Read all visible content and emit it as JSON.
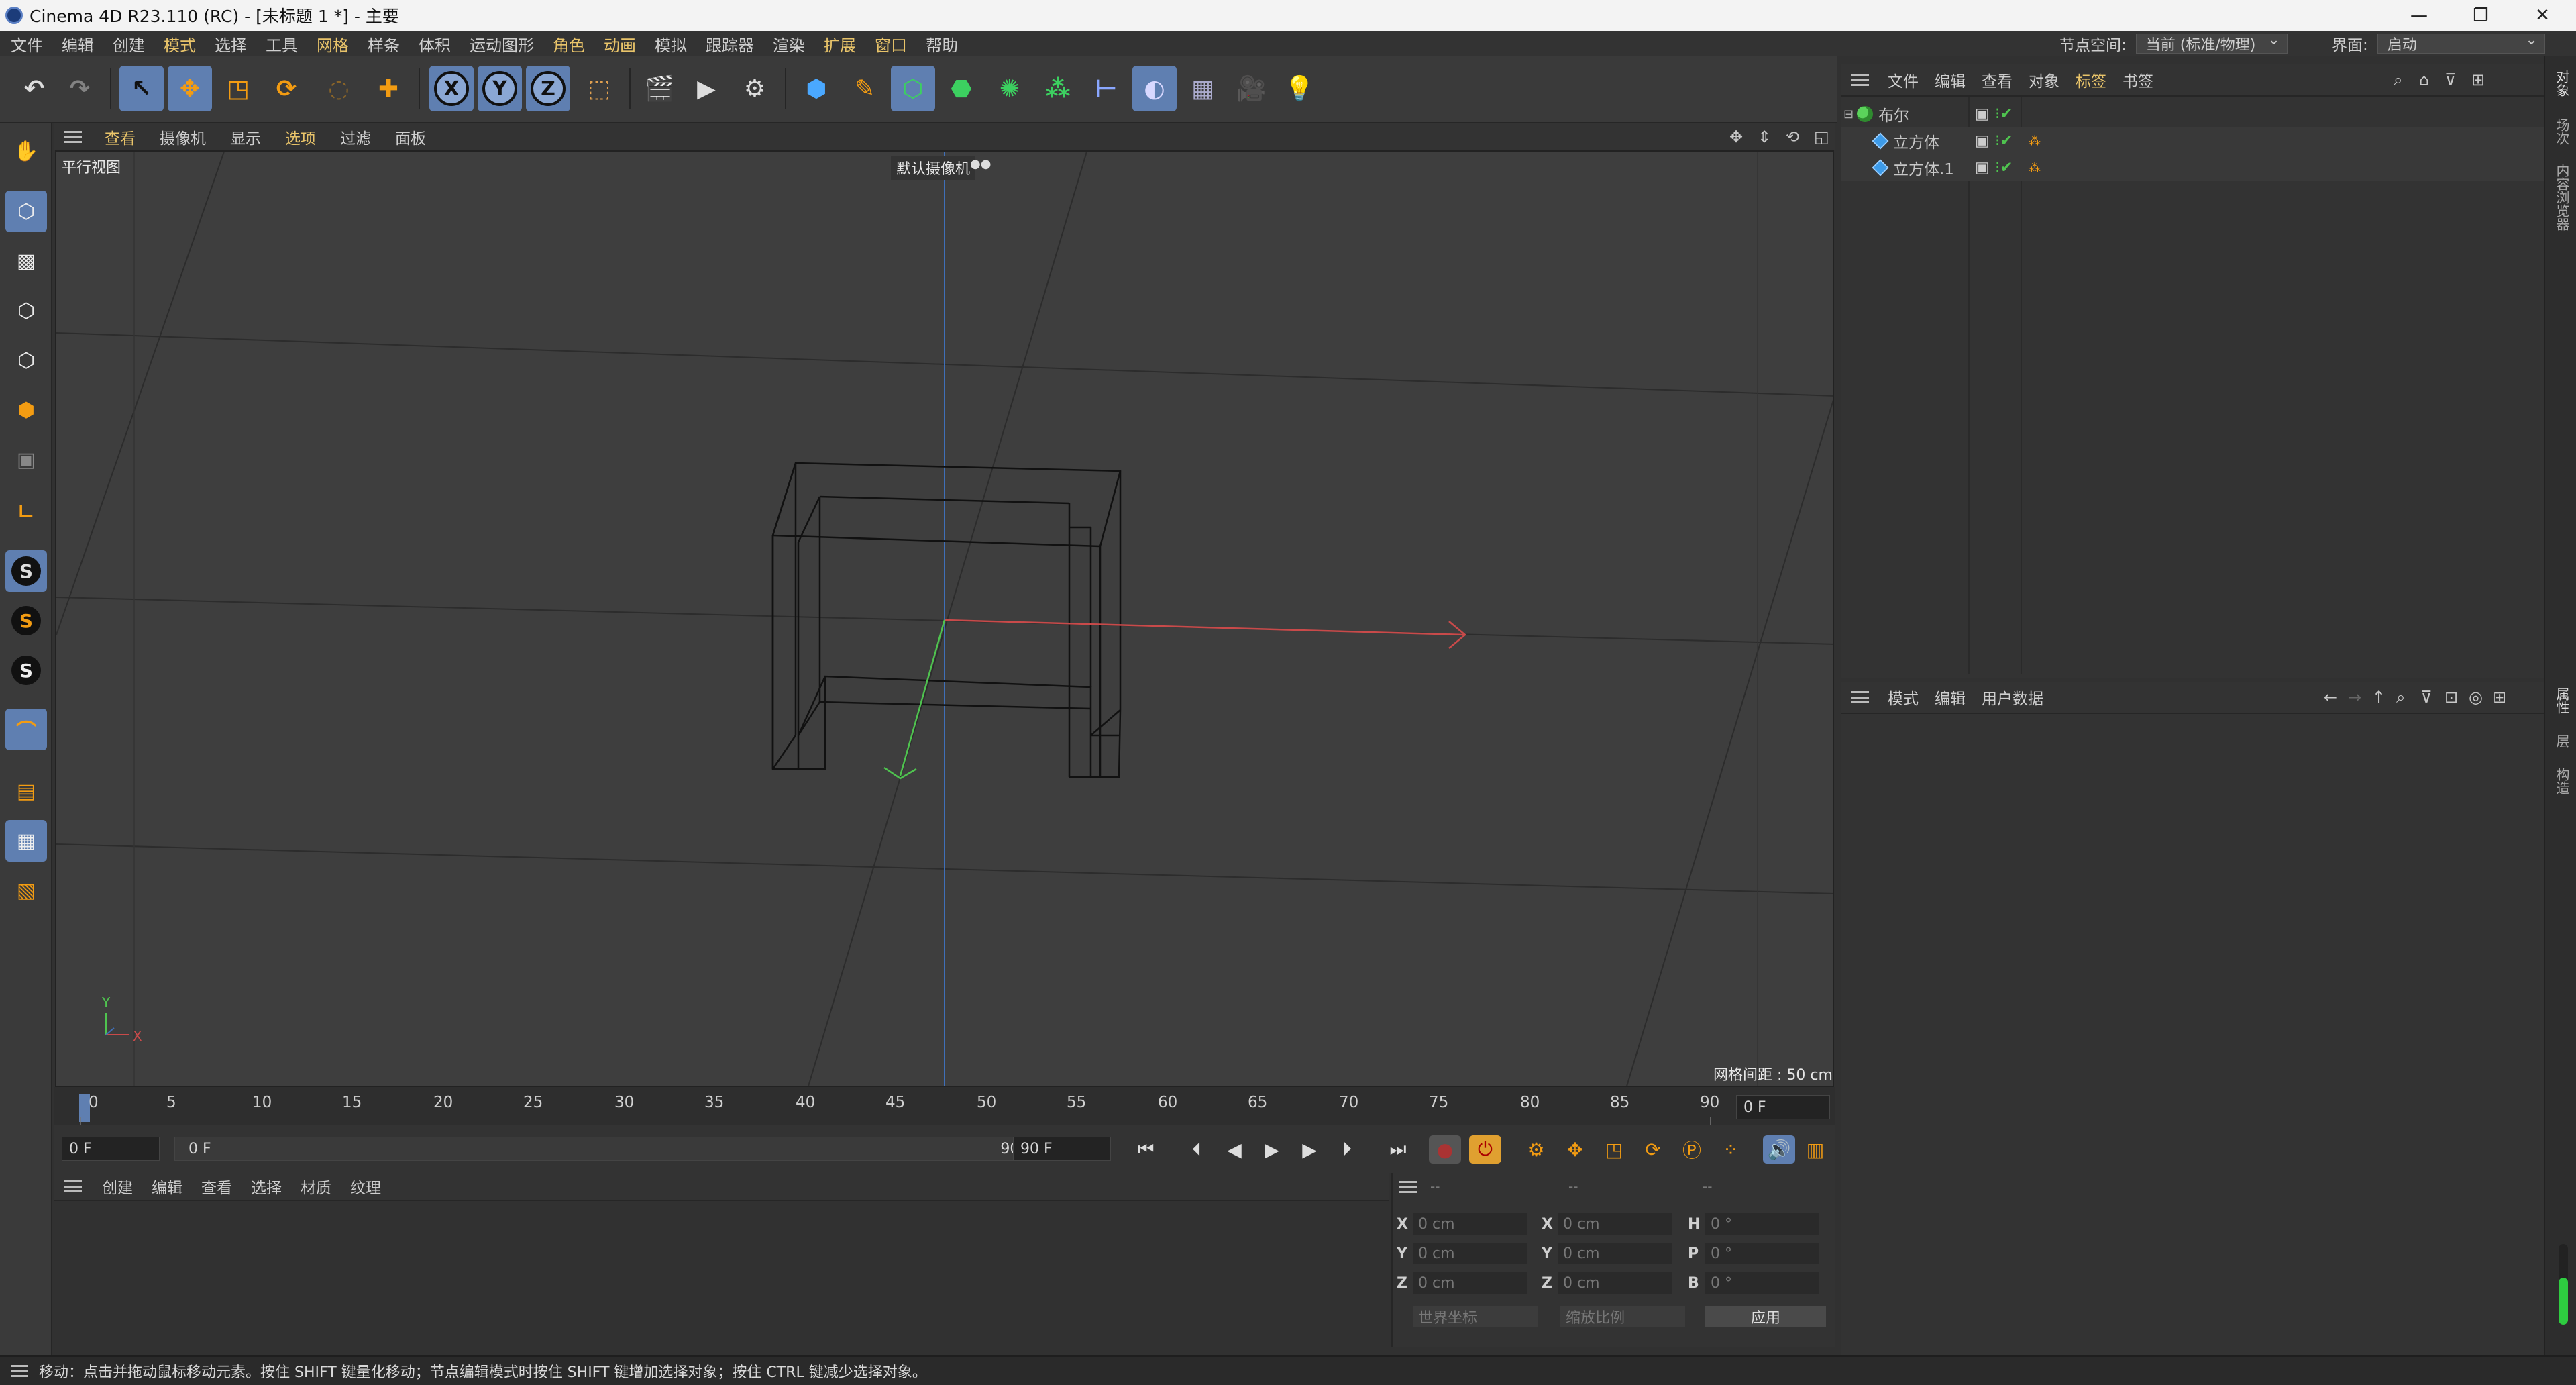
{
  "window": {
    "title": "Cinema 4D R23.110 (RC) - [未标题 1 *] - 主要",
    "minimize": "—",
    "maximize": "❐",
    "close": "✕"
  },
  "menubar": {
    "items": [
      "文件",
      "编辑",
      "创建",
      "模式",
      "选择",
      "工具",
      "网格",
      "样条",
      "体积",
      "运动图形",
      "角色",
      "动画",
      "模拟",
      "跟踪器",
      "渲染",
      "扩展",
      "窗口",
      "帮助"
    ],
    "node_space_label": "节点空间:",
    "node_space_value": "当前 (标准/物理)",
    "layout_label": "界面:",
    "layout_value": "启动"
  },
  "viewport": {
    "menu": [
      "查看",
      "摄像机",
      "显示",
      "选项",
      "过滤",
      "面板"
    ],
    "view_name": "平行视图",
    "camera": "默认摄像机",
    "grid_spacing": "网格间距 : 50 cm",
    "axis_y": "Y",
    "axis_x": "X"
  },
  "timeline": {
    "ticks": [
      "0",
      "5",
      "10",
      "15",
      "20",
      "25",
      "30",
      "35",
      "40",
      "45",
      "50",
      "55",
      "60",
      "65",
      "70",
      "75",
      "80",
      "85",
      "90"
    ],
    "current_frame": "0 F",
    "start_frame": "0 F",
    "range_start": "0 F",
    "range_end": "90 F",
    "end_frame": "90 F"
  },
  "material_menu": [
    "创建",
    "编辑",
    "查看",
    "选择",
    "材质",
    "纹理"
  ],
  "coords": {
    "headers": [
      "--",
      "--",
      "--"
    ],
    "rows": [
      {
        "a": "X",
        "av": "0 cm",
        "b": "X",
        "bv": "0 cm",
        "c": "H",
        "cv": "0 °"
      },
      {
        "a": "Y",
        "av": "0 cm",
        "b": "Y",
        "bv": "0 cm",
        "c": "P",
        "cv": "0 °"
      },
      {
        "a": "Z",
        "av": "0 cm",
        "b": "Z",
        "bv": "0 cm",
        "c": "B",
        "cv": "0 °"
      }
    ],
    "coord_system": "世界坐标",
    "scale_mode": "缩放比例",
    "apply": "应用"
  },
  "objects": {
    "menu": [
      "文件",
      "编辑",
      "查看",
      "对象",
      "标签",
      "书签"
    ],
    "items": [
      {
        "name": "布尔",
        "type": "boole"
      },
      {
        "name": "立方体",
        "type": "cube"
      },
      {
        "name": "立方体.1",
        "type": "cube"
      }
    ]
  },
  "attributes": {
    "menu": [
      "模式",
      "编辑",
      "用户数据"
    ]
  },
  "side_tabs": [
    "对象",
    "场次",
    "内容浏览器",
    "属性",
    "层",
    "构造"
  ],
  "status": "移动：点击并拖动鼠标移动元素。按住 SHIFT 键量化移动；节点编辑模式时按住 SHIFT 键增加选择对象；按住 CTRL 键减少选择对象。"
}
